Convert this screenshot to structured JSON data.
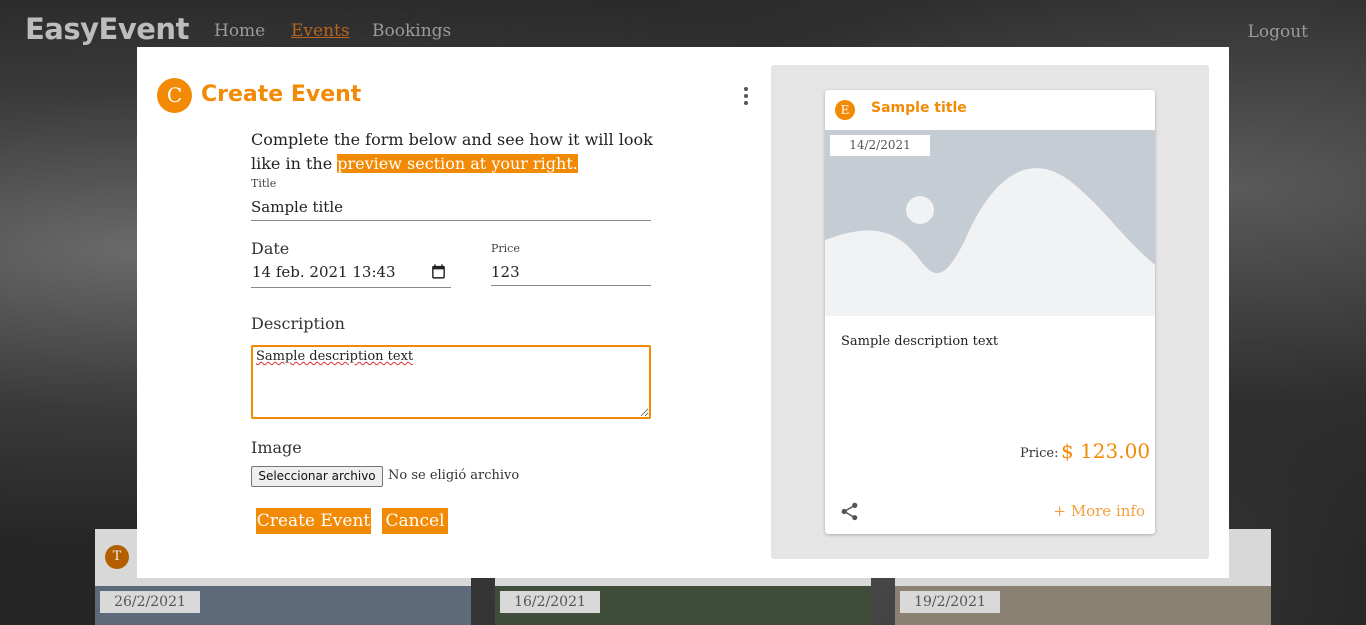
{
  "navbar": {
    "brand": "EasyEvent",
    "links": [
      "Home",
      "Events",
      "Bookings"
    ],
    "logout": "Logout"
  },
  "background_cards": [
    {
      "avatar": "T",
      "date": "26/2/2021"
    },
    {
      "avatar": "",
      "date": "16/2/2021"
    },
    {
      "avatar": "",
      "date": "19/2/2021"
    }
  ],
  "modal": {
    "avatar_letter": "C",
    "title": "Create Event",
    "intro_text": "Complete the form below and see how it will look like in the ",
    "intro_highlight": "preview section at your right.",
    "title_label": "Title",
    "title_value": "Sample title",
    "date_label": "Date",
    "date_value": "14 feb. 2021 13:43",
    "price_label": "Price",
    "price_value": "123",
    "description_label": "Description",
    "description_value": "Sample description text",
    "image_label": "Image",
    "file_button": "Seleccionar archivo",
    "file_status": "No se eligió archivo",
    "create_button": "Create Event",
    "cancel_button": "Cancel"
  },
  "preview": {
    "avatar_letter": "E",
    "title": "Sample title",
    "date": "14/2/2021",
    "description": "Sample description text",
    "price_label": "Price:",
    "price_value": "$ 123.00",
    "more_info": "+ More info"
  },
  "colors": {
    "accent": "#f28a05",
    "placeholder_image": "#c5ccd3",
    "preview_panel": "#e5e5e5"
  },
  "icons": [
    "kebab-menu-icon",
    "calendar-icon",
    "share-icon",
    "image-placeholder-icon"
  ]
}
